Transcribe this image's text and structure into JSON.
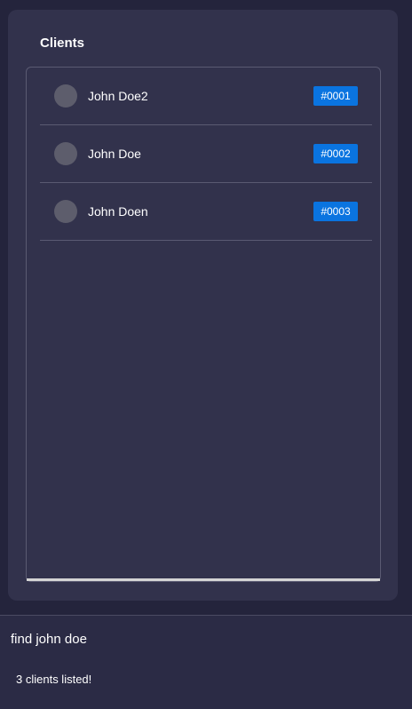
{
  "panel": {
    "title": "Clients"
  },
  "clients": [
    {
      "name": "John Doe2",
      "id": "#0001"
    },
    {
      "name": "John Doe",
      "id": "#0002"
    },
    {
      "name": "John Doen",
      "id": "#0003"
    }
  ],
  "command": {
    "text": "find john doe"
  },
  "result": {
    "text": "3 clients listed!"
  },
  "colors": {
    "background": "#24243c",
    "panel": "#32324c",
    "badge": "#0a74e0",
    "avatar": "#5d5d6c"
  }
}
